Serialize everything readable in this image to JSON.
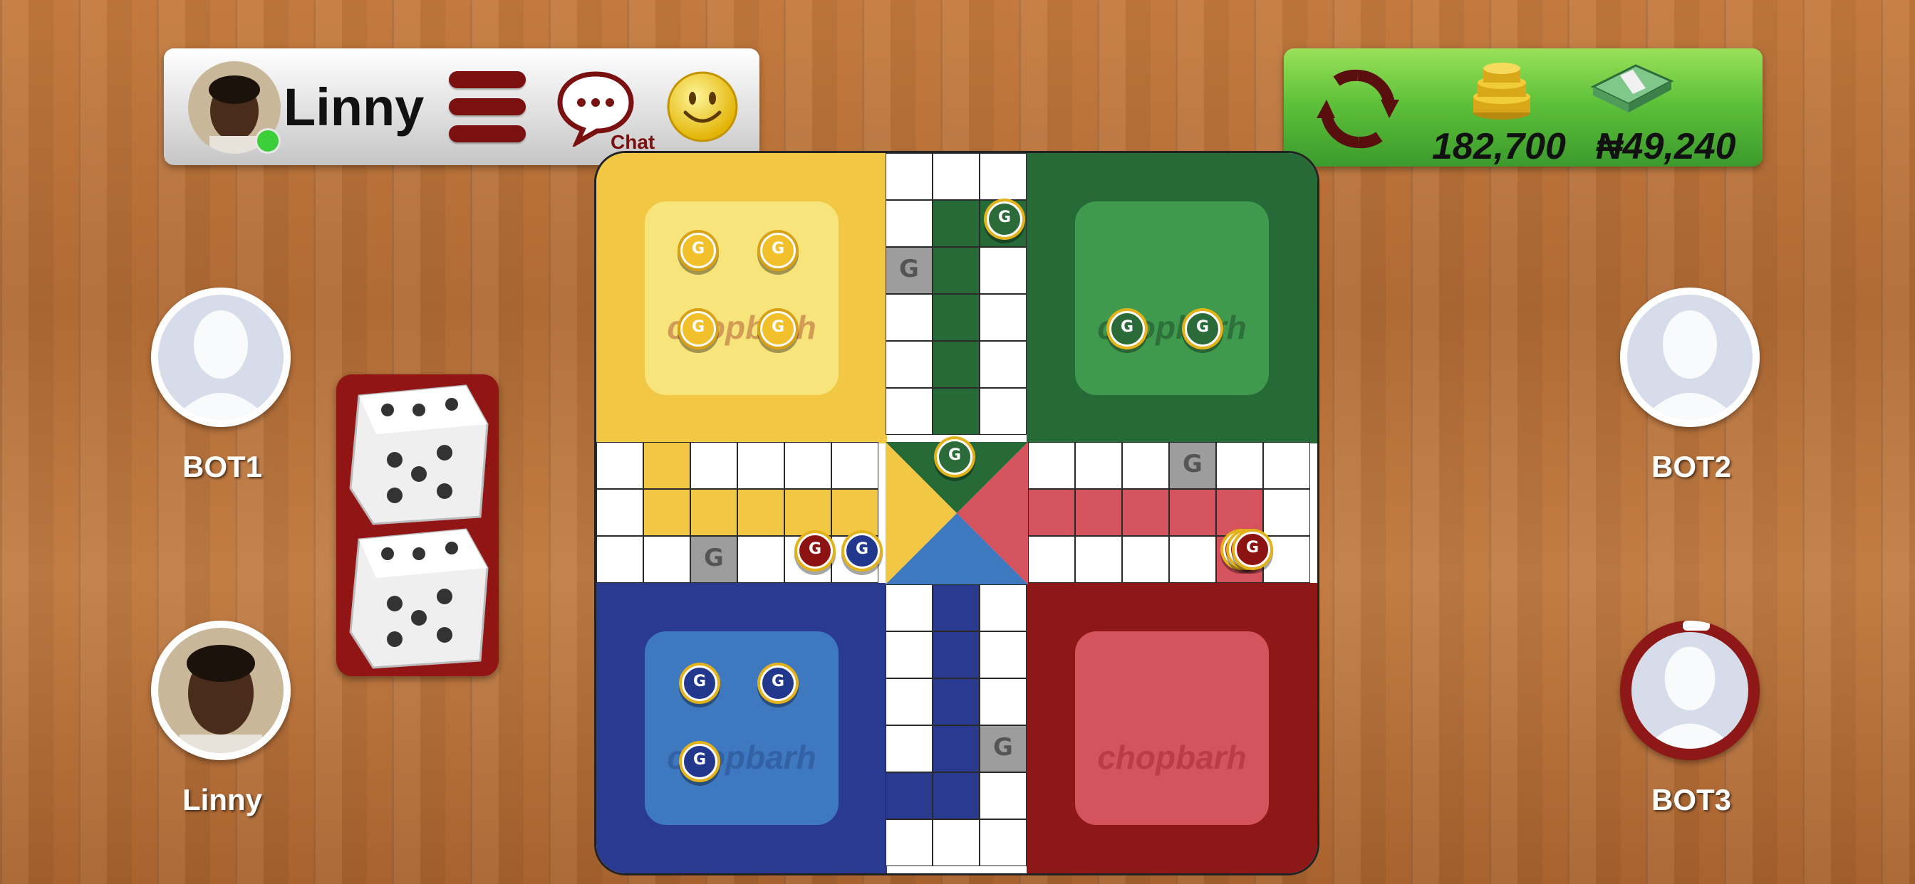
{
  "header": {
    "username": "Linny",
    "chat_label": "Chat",
    "icons": [
      "avatar",
      "menu-icon",
      "chat-icon",
      "emoji-icon"
    ]
  },
  "wallet": {
    "coins": "182,700",
    "cash": "₦49,240",
    "icons": [
      "refresh-icon",
      "coins-icon",
      "cash-icon"
    ]
  },
  "players": {
    "top_left": "BOT1",
    "top_right": "BOT2",
    "bottom_left": "Linny",
    "bottom_right": "BOT3"
  },
  "board": {
    "brand": "chopbarh",
    "colors": {
      "yellow": "#f2c744",
      "green": "#266a38",
      "blue": "#2a3a8e",
      "red": "#8e1717",
      "yellow_light": "#f7e47a",
      "green_light": "#3f9a4e",
      "blue_light": "#3e79bf",
      "red_light": "#d4535d"
    }
  },
  "dice": {
    "values": [
      5,
      5
    ]
  }
}
